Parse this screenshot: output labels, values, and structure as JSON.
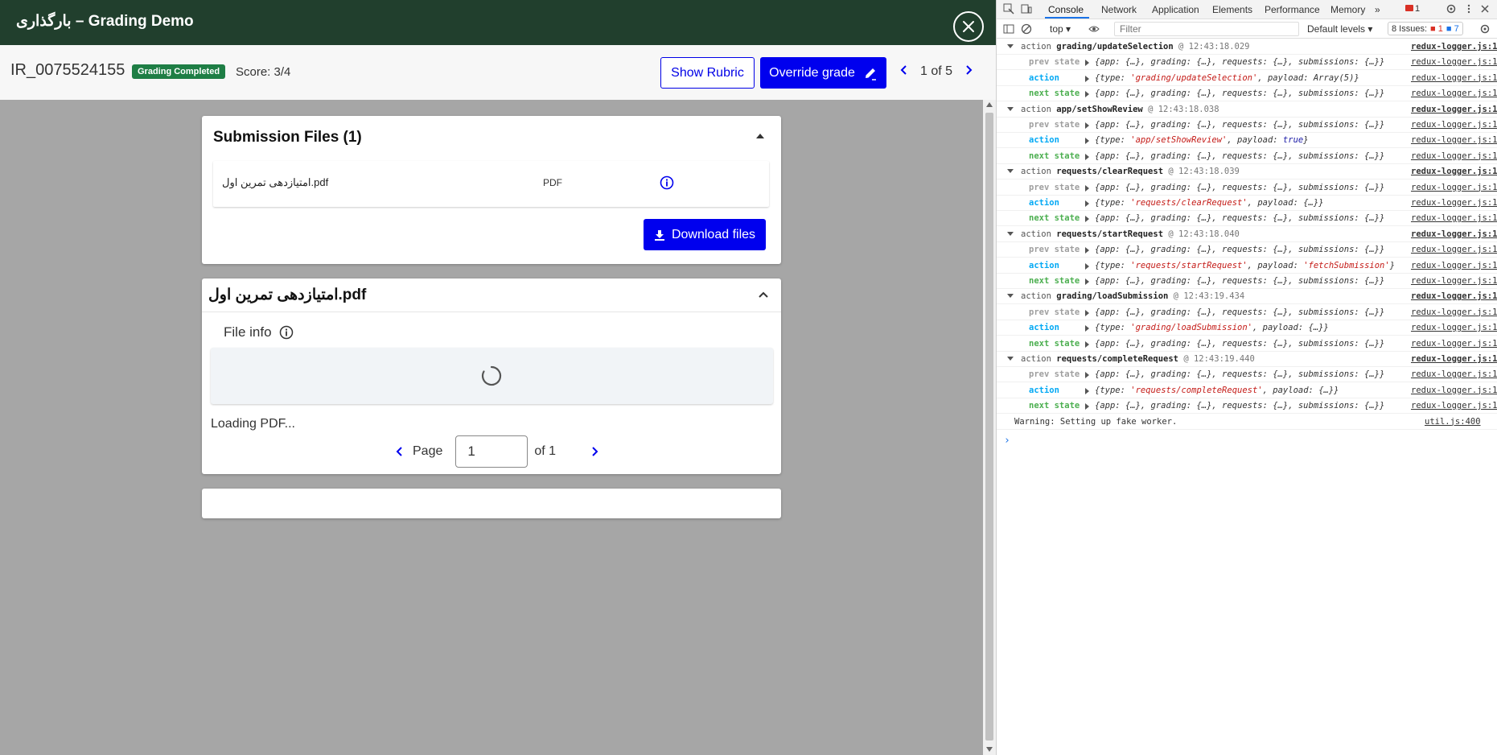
{
  "app": {
    "title": "بارگذاری – Grading Demo",
    "submission_id": "IR_0075524155",
    "status_badge": "Grading Completed",
    "score": "Score: 3/4",
    "show_rubric_label": "Show Rubric",
    "override_grade_label": "Override grade",
    "pager_text": "1 of 5",
    "colors": {
      "header": "#213f2d",
      "primary": "#0000ee",
      "badge": "#1e7e45",
      "background": "#a6a6a6"
    }
  },
  "submission_files": {
    "title": "Submission Files (1)",
    "files": [
      {
        "name": "امتیازدهی تمرین اول.pdf",
        "type": "PDF"
      }
    ],
    "download_label": "Download files"
  },
  "viewer": {
    "title": "امتیازدهی تمرین اول.pdf",
    "file_info_label": "File info",
    "loading_text": "Loading PDF...",
    "page_label": "Page",
    "page_value": "1",
    "page_total": "of 1"
  },
  "devtools": {
    "tabs": [
      "Console",
      "Network",
      "Application",
      "Elements",
      "Performance",
      "Memory"
    ],
    "active_tab": "Console",
    "error_count": "1",
    "context": "top",
    "filter_placeholder": "Filter",
    "levels": "Default levels",
    "issues_label": "8 Issues:",
    "issues_errors": "1",
    "issues_info": "7",
    "groups": [
      {
        "name": "grading/updateSelection",
        "time": "@ 12:43:18.029",
        "prev": "{app: {…}, grading: {…}, requests: {…}, submissions: {…}}",
        "action_type": "'grading/updateSelection'",
        "action_payload": "Array(5)",
        "payload_kind": "plain",
        "next": "{app: {…}, grading: {…}, requests: {…}, submissions: {…}}",
        "link": "redux-logger.js:1"
      },
      {
        "name": "app/setShowReview",
        "time": "@ 12:43:18.038",
        "prev": "{app: {…}, grading: {…}, requests: {…}, submissions: {…}}",
        "action_type": "'app/setShowReview'",
        "action_payload": "true",
        "payload_kind": "kw",
        "next": "{app: {…}, grading: {…}, requests: {…}, submissions: {…}}",
        "link": "redux-logger.js:1"
      },
      {
        "name": "requests/clearRequest",
        "time": "@ 12:43:18.039",
        "prev": "{app: {…}, grading: {…}, requests: {…}, submissions: {…}}",
        "action_type": "'requests/clearRequest'",
        "action_payload": "{…}",
        "payload_kind": "plain",
        "next": "{app: {…}, grading: {…}, requests: {…}, submissions: {…}}",
        "link": "redux-logger.js:1"
      },
      {
        "name": "requests/startRequest",
        "time": "@ 12:43:18.040",
        "prev": "{app: {…}, grading: {…}, requests: {…}, submissions: {…}}",
        "action_type": "'requests/startRequest'",
        "action_payload": "'fetchSubmission'",
        "payload_kind": "str",
        "next": "{app: {…}, grading: {…}, requests: {…}, submissions: {…}}",
        "link": "redux-logger.js:1"
      },
      {
        "name": "grading/loadSubmission",
        "time": "@ 12:43:19.434",
        "prev": "{app: {…}, grading: {…}, requests: {…}, submissions: {…}}",
        "action_type": "'grading/loadSubmission'",
        "action_payload": "{…}",
        "payload_kind": "plain",
        "next": "{app: {…}, grading: {…}, requests: {…}, submissions: {…}}",
        "link": "redux-logger.js:1"
      },
      {
        "name": "requests/completeRequest",
        "time": "@ 12:43:19.440",
        "prev": "{app: {…}, grading: {…}, requests: {…}, submissions: {…}}",
        "action_type": "'requests/completeRequest'",
        "action_payload": "{…}",
        "payload_kind": "plain",
        "next": "{app: {…}, grading: {…}, requests: {…}, submissions: {…}}",
        "link": "redux-logger.js:1"
      }
    ],
    "labels": {
      "group_prefix": "action",
      "prev": "prev state",
      "action": "action",
      "next": "next state"
    },
    "warning": {
      "text": "Warning: Setting up fake worker.",
      "link": "util.js:400"
    }
  }
}
